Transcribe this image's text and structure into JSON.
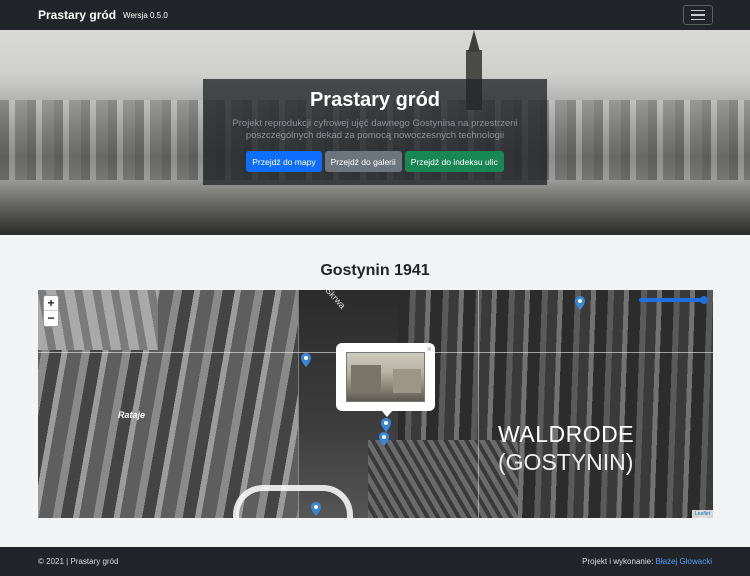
{
  "navbar": {
    "brand": "Prastary gród",
    "version": "Wersja 0.5.0",
    "menu_icon": "hamburger-icon"
  },
  "hero": {
    "title": "Prastary gród",
    "subtitle": "Projekt reprodukcji cyfrowej ujęć dawnego Gostynina na przestrzeni poszczególnych dekad za pomocą nowoczesnych technologii",
    "buttons": {
      "map": "Przejdź do mapy",
      "gallery": "Przejdź do galerii",
      "streets": "Przejdź do indeksu ulic"
    }
  },
  "section": {
    "title": "Gostynin 1941"
  },
  "map": {
    "zoom_in": "+",
    "zoom_out": "−",
    "popup_close": "×",
    "labels": {
      "waldrode_line1": "WALDRODE",
      "waldrode_line2": "(GOSTYNIN)",
      "rataje": "Rataje",
      "warta": "Skrwa"
    },
    "attribution": "Leaflet",
    "marker_color": "#3a86d6"
  },
  "footer": {
    "copyright": "© 2021 | Prastary gród",
    "credit_prefix": "Projekt i wykonanie:",
    "credit_name": "Błażej Głowacki"
  },
  "colors": {
    "navbar": "#212529",
    "primary": "#0d6efd",
    "secondary": "#6c757d",
    "success": "#198754",
    "link": "#4f9cf4"
  }
}
